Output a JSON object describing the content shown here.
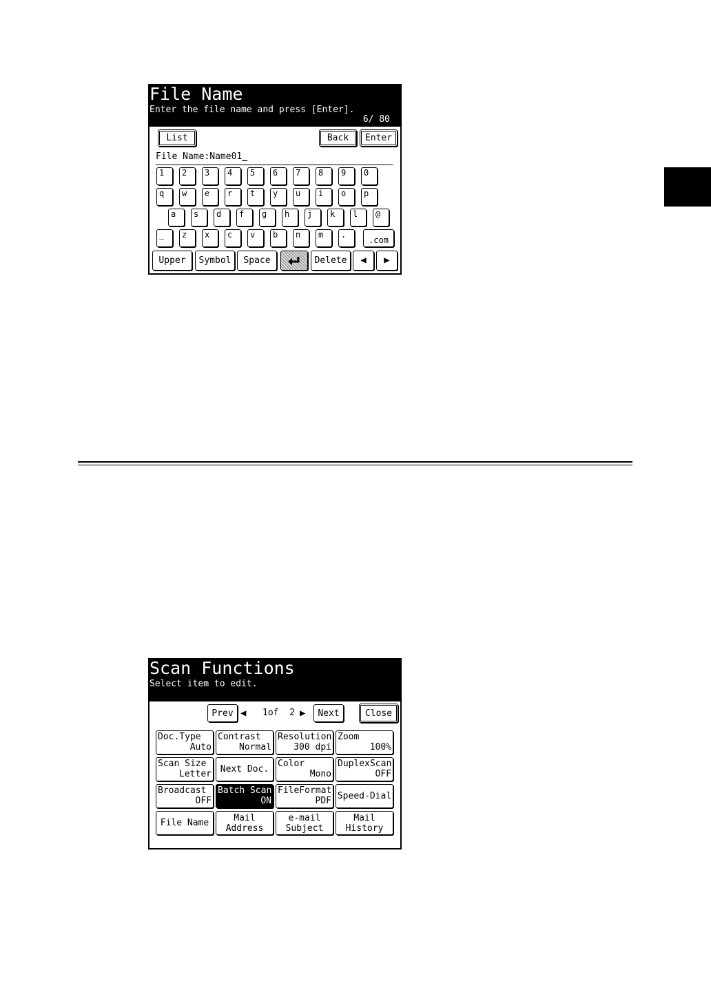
{
  "file_name_screen": {
    "title": "File Name",
    "subtitle": "Enter the file name and press [Enter].",
    "counter": "6/ 80",
    "list_label": "List",
    "back_label": "Back",
    "enter_label": "Enter",
    "field_label": "File Name:",
    "field_value": "Name01",
    "cursor": "_",
    "rows": [
      [
        "1",
        "2",
        "3",
        "4",
        "5",
        "6",
        "7",
        "8",
        "9",
        "0"
      ],
      [
        "q",
        "w",
        "e",
        "r",
        "t",
        "y",
        "u",
        "i",
        "o",
        "p"
      ],
      [
        "a",
        "s",
        "d",
        "f",
        "g",
        "h",
        "j",
        "k",
        "l",
        "@"
      ],
      [
        "_",
        "z",
        "x",
        "c",
        "v",
        "b",
        "n",
        "m",
        "."
      ]
    ],
    "dotcom_label": ".com",
    "upper_label": "Upper",
    "symbol_label": "Symbol",
    "space_label": "Space",
    "return_icon": "return-arrow-icon",
    "delete_label": "Delete",
    "left_glyph": "◀",
    "right_glyph": "▶"
  },
  "scan_functions_screen": {
    "title": "Scan Functions",
    "subtitle": "Select item to edit.",
    "prev_label": "Prev",
    "page_left_glyph": "◀",
    "page_indicator": "1of  2",
    "page_right_glyph": "▶",
    "next_label": "Next",
    "close_label": "Close",
    "items": [
      {
        "line1": "Doc.Type",
        "line2": "Auto"
      },
      {
        "line1": "Contrast",
        "line2": "Normal"
      },
      {
        "line1": "Resolution",
        "line2": "300 dpi"
      },
      {
        "line1": "Zoom",
        "line2": "100%"
      },
      {
        "line1": "Scan Size",
        "line2": "Letter"
      },
      {
        "line1": "Next Doc.",
        "line2": ""
      },
      {
        "line1": "Color",
        "line2": "Mono"
      },
      {
        "line1": "DuplexScan",
        "line2": "OFF"
      },
      {
        "line1": "Broadcast",
        "line2": "OFF"
      },
      {
        "line1": "Batch Scan",
        "line2": "ON"
      },
      {
        "line1": "FileFormat",
        "line2": "PDF"
      },
      {
        "line1": "Speed-Dial",
        "line2": ""
      },
      {
        "line1": "File Name",
        "line2": ""
      },
      {
        "line1": "Mail",
        "line2": "Address"
      },
      {
        "line1": "e-mail",
        "line2": "Subject"
      },
      {
        "line1": "Mail",
        "line2": "History"
      }
    ]
  }
}
